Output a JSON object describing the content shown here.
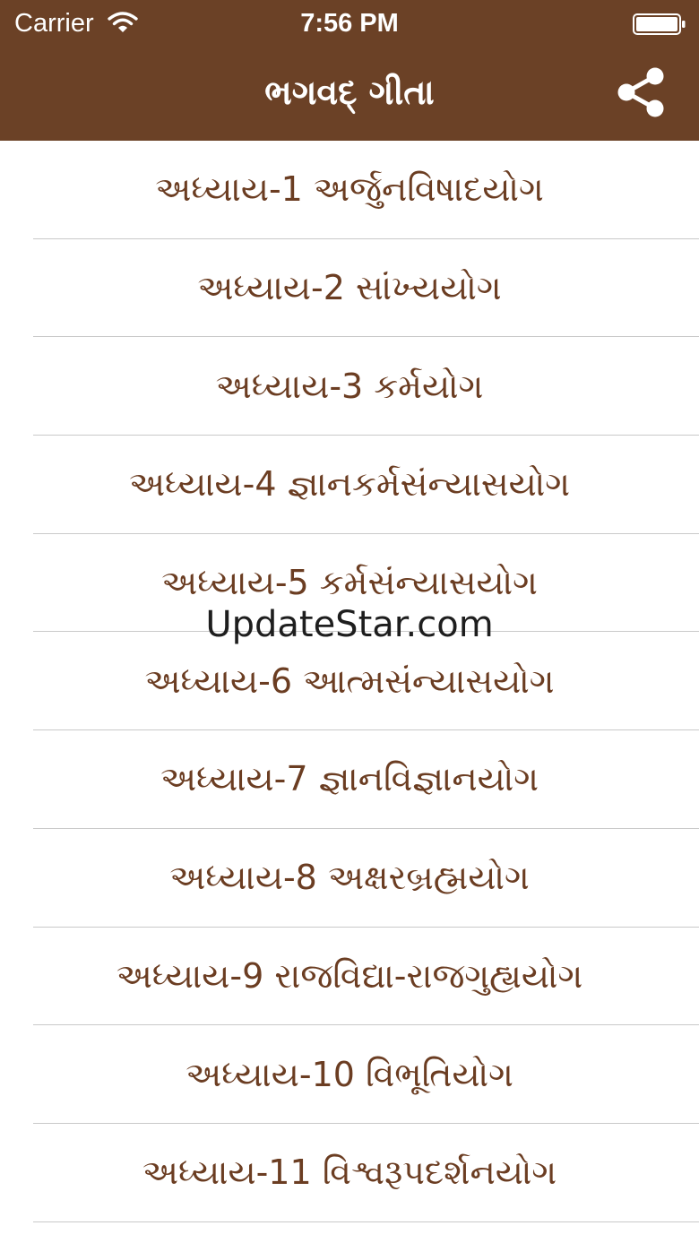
{
  "status_bar": {
    "carrier": "Carrier",
    "time": "7:56 PM",
    "wifi_icon": "wifi-icon",
    "battery_icon": "battery-icon"
  },
  "nav_bar": {
    "title": "ભગવદ્ ગીતા",
    "share_icon": "share-icon",
    "background_color": "#6b4126"
  },
  "chapters": [
    {
      "label": "અધ્યાય-1  અર્જુનવિષાદયોગ"
    },
    {
      "label": "અધ્યાય-2  સાંખ્યયોગ"
    },
    {
      "label": "અધ્યાય-3  કર્મયોગ"
    },
    {
      "label": "અધ્યાય-4  જ્ઞાનકર્મસંન્યાસયોગ"
    },
    {
      "label": "અધ્યાય-5  કર્મસંન્યાસયોગ"
    },
    {
      "label": "અધ્યાય-6  આત્મસંન્યાસયોગ"
    },
    {
      "label": "અધ્યાય-7  જ્ઞાનવિજ્ઞાનયોગ"
    },
    {
      "label": "અધ્યાય-8  અક્ષરબ્રહ્મયોગ"
    },
    {
      "label": "અધ્યાય-9  રાજવિદ્યા-રાજગુહ્યયોગ"
    },
    {
      "label": "અધ્યાય-10  વિભૂતિયોગ"
    },
    {
      "label": "અધ્યાય-11  વિશ્વરૂપદર્શનયોગ"
    }
  ],
  "watermark": "UpdateStar.com",
  "colors": {
    "text": "#6b3d22",
    "divider": "#c9c9c9"
  }
}
